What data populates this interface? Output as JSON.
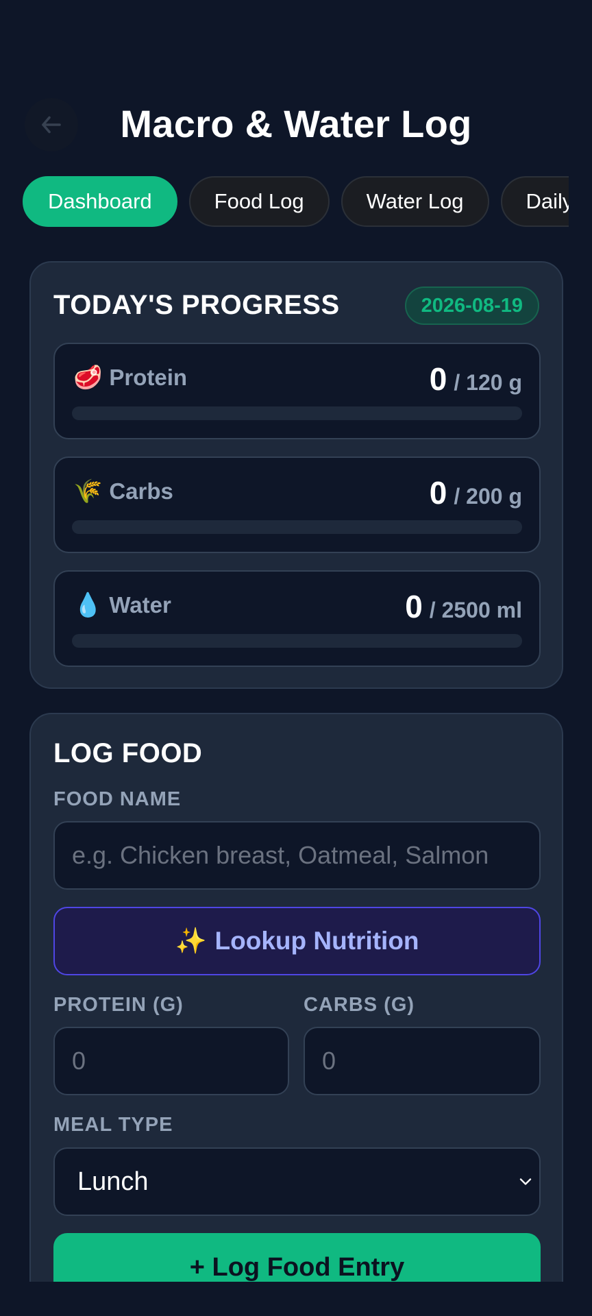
{
  "header": {
    "title": "Macro & Water Log",
    "back_icon": "arrow-left-icon"
  },
  "tabs": [
    {
      "label": "Dashboard",
      "active": true
    },
    {
      "label": "Food Log",
      "active": false
    },
    {
      "label": "Water Log",
      "active": false
    },
    {
      "label": "Daily",
      "active": false
    }
  ],
  "progress": {
    "title": "TODAY'S PROGRESS",
    "date": "2026-08-19",
    "metrics": [
      {
        "icon": "🥩",
        "icon_name": "meat-icon",
        "label": "Protein",
        "current": "0",
        "goal": "/ 120 g",
        "fill_percent": 0
      },
      {
        "icon": "🌾",
        "icon_name": "wheat-icon",
        "label": "Carbs",
        "current": "0",
        "goal": "/ 200 g",
        "fill_percent": 0
      },
      {
        "icon": "💧",
        "icon_name": "droplet-icon",
        "label": "Water",
        "current": "0",
        "goal": "/ 2500 ml",
        "fill_percent": 0
      }
    ]
  },
  "log_food": {
    "title": "LOG FOOD",
    "food_name_label": "FOOD NAME",
    "food_name_placeholder": "e.g. Chicken breast, Oatmeal, Salmon",
    "lookup_icon": "✨",
    "lookup_label": "Lookup Nutrition",
    "protein_label": "PROTEIN (G)",
    "protein_placeholder": "0",
    "carbs_label": "CARBS (G)",
    "carbs_placeholder": "0",
    "meal_type_label": "MEAL TYPE",
    "meal_type_value": "Lunch",
    "submit_label": "+ Log Food Entry"
  },
  "colors": {
    "background": "#0e1628",
    "card": "#1e293b",
    "accent": "#10b981",
    "lookup_bg": "#1e1b4b",
    "lookup_text": "#a5b4fc"
  }
}
